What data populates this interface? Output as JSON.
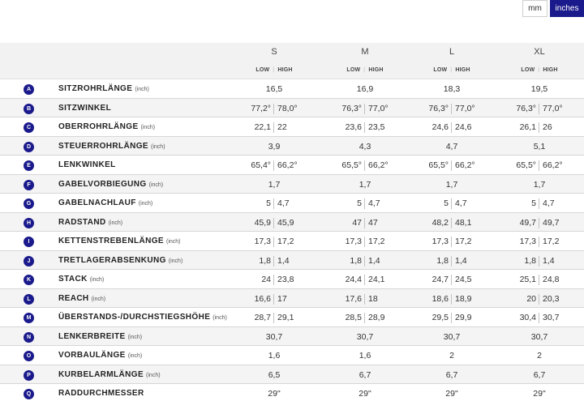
{
  "units": {
    "mm": "mm",
    "inches": "inches",
    "selected": "inches"
  },
  "sizes": [
    "S",
    "M",
    "L",
    "XL"
  ],
  "low_label": "LOW",
  "high_label": "HIGH",
  "accent_color": "#1a1a8c",
  "rows": [
    {
      "letter": "A",
      "name": "SITZROHRLÄNGE",
      "unit": "(inch)",
      "values": [
        [
          "16,5"
        ],
        [
          "16,9"
        ],
        [
          "18,3"
        ],
        [
          "19,5"
        ]
      ]
    },
    {
      "letter": "B",
      "name": "SITZWINKEL",
      "unit": "",
      "values": [
        [
          "77,2°",
          "78,0°"
        ],
        [
          "76,3°",
          "77,0°"
        ],
        [
          "76,3°",
          "77,0°"
        ],
        [
          "76,3°",
          "77,0°"
        ]
      ]
    },
    {
      "letter": "C",
      "name": "OBERROHRLÄNGE",
      "unit": "(inch)",
      "values": [
        [
          "22,1",
          "22"
        ],
        [
          "23,6",
          "23,5"
        ],
        [
          "24,6",
          "24,6"
        ],
        [
          "26,1",
          "26"
        ]
      ]
    },
    {
      "letter": "D",
      "name": "STEUERROHRLÄNGE",
      "unit": "(inch)",
      "values": [
        [
          "3,9"
        ],
        [
          "4,3"
        ],
        [
          "4,7"
        ],
        [
          "5,1"
        ]
      ]
    },
    {
      "letter": "E",
      "name": "LENKWINKEL",
      "unit": "",
      "values": [
        [
          "65,4°",
          "66,2°"
        ],
        [
          "65,5°",
          "66,2°"
        ],
        [
          "65,5°",
          "66,2°"
        ],
        [
          "65,5°",
          "66,2°"
        ]
      ]
    },
    {
      "letter": "F",
      "name": "GABELVORBIEGUNG",
      "unit": "(inch)",
      "values": [
        [
          "1,7"
        ],
        [
          "1,7"
        ],
        [
          "1,7"
        ],
        [
          "1,7"
        ]
      ]
    },
    {
      "letter": "G",
      "name": "GABELNACHLAUF",
      "unit": "(inch)",
      "values": [
        [
          "5",
          "4,7"
        ],
        [
          "5",
          "4,7"
        ],
        [
          "5",
          "4,7"
        ],
        [
          "5",
          "4,7"
        ]
      ]
    },
    {
      "letter": "H",
      "name": "RADSTAND",
      "unit": "(inch)",
      "values": [
        [
          "45,9",
          "45,9"
        ],
        [
          "47",
          "47"
        ],
        [
          "48,2",
          "48,1"
        ],
        [
          "49,7",
          "49,7"
        ]
      ]
    },
    {
      "letter": "I",
      "name": "KETTENSTREBENLÄNGE",
      "unit": "(inch)",
      "values": [
        [
          "17,3",
          "17,2"
        ],
        [
          "17,3",
          "17,2"
        ],
        [
          "17,3",
          "17,2"
        ],
        [
          "17,3",
          "17,2"
        ]
      ]
    },
    {
      "letter": "J",
      "name": "TRETLAGERABSENKUNG",
      "unit": "(inch)",
      "values": [
        [
          "1,8",
          "1,4"
        ],
        [
          "1,8",
          "1,4"
        ],
        [
          "1,8",
          "1,4"
        ],
        [
          "1,8",
          "1,4"
        ]
      ]
    },
    {
      "letter": "K",
      "name": "STACK",
      "unit": "(inch)",
      "values": [
        [
          "24",
          "23,8"
        ],
        [
          "24,4",
          "24,1"
        ],
        [
          "24,7",
          "24,5"
        ],
        [
          "25,1",
          "24,8"
        ]
      ]
    },
    {
      "letter": "L",
      "name": "REACH",
      "unit": "(inch)",
      "values": [
        [
          "16,6",
          "17"
        ],
        [
          "17,6",
          "18"
        ],
        [
          "18,6",
          "18,9"
        ],
        [
          "20",
          "20,3"
        ]
      ]
    },
    {
      "letter": "M",
      "name": "ÜBERSTANDS-/DURCHSTIEGSHÖHE",
      "unit": "(inch)",
      "values": [
        [
          "28,7",
          "29,1"
        ],
        [
          "28,5",
          "28,9"
        ],
        [
          "29,5",
          "29,9"
        ],
        [
          "30,4",
          "30,7"
        ]
      ]
    },
    {
      "letter": "N",
      "name": "LENKERBREITE",
      "unit": "(inch)",
      "values": [
        [
          "30,7"
        ],
        [
          "30,7"
        ],
        [
          "30,7"
        ],
        [
          "30,7"
        ]
      ]
    },
    {
      "letter": "O",
      "name": "VORBAULÄNGE",
      "unit": "(inch)",
      "values": [
        [
          "1,6"
        ],
        [
          "1,6"
        ],
        [
          "2"
        ],
        [
          "2"
        ]
      ]
    },
    {
      "letter": "P",
      "name": "KURBELARMLÄNGE",
      "unit": "(inch)",
      "values": [
        [
          "6,5"
        ],
        [
          "6,7"
        ],
        [
          "6,7"
        ],
        [
          "6,7"
        ]
      ]
    },
    {
      "letter": "Q",
      "name": "RADDURCHMESSER",
      "unit": "",
      "values": [
        [
          "29\""
        ],
        [
          "29\""
        ],
        [
          "29\""
        ],
        [
          "29\""
        ]
      ]
    }
  ]
}
